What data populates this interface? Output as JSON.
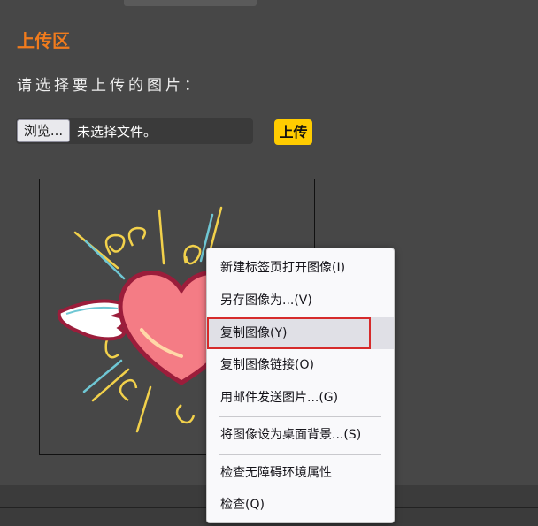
{
  "upload": {
    "title": "上传区",
    "prompt": "请选择要上传的图片：",
    "browse_label": "浏览...",
    "file_status": "未选择文件。",
    "upload_label": "上传"
  },
  "context_menu": {
    "items": [
      {
        "label": "新建标签页打开图像(I)"
      },
      {
        "label": "另存图像为...(V)"
      },
      {
        "label": "复制图像(Y)"
      },
      {
        "label": "复制图像链接(O)"
      },
      {
        "label": "用邮件发送图片...(G)"
      },
      {
        "label": "将图像设为桌面背景...(S)"
      },
      {
        "label": "检查无障碍环境属性"
      },
      {
        "label": "检查(Q)"
      }
    ],
    "highlighted_index": 2
  },
  "colors": {
    "accent_title": "#f07b1d",
    "upload_button": "#ffcc00",
    "highlight_border": "#d62b2b"
  }
}
